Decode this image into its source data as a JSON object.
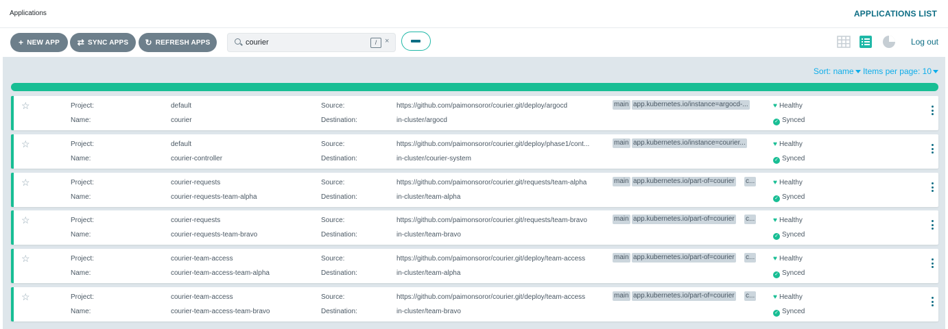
{
  "header": {
    "breadcrumb": "Applications",
    "page_title": "APPLICATIONS LIST"
  },
  "toolbar": {
    "new_app": "NEW APP",
    "sync_apps": "SYNC APPS",
    "refresh_apps": "REFRESH APPS",
    "search_value": "courier",
    "search_shortcut": "/",
    "clear": "×",
    "logout": "Log out"
  },
  "sort": {
    "label": "Sort: name",
    "per_page": "Items per page: 10"
  },
  "labels": {
    "project": "Project:",
    "name": "Name:",
    "source": "Source:",
    "destination": "Destination:",
    "healthy": "Healthy",
    "synced": "Synced"
  },
  "colors": {
    "accent": "#0d6d84",
    "healthy": "#18be94",
    "button": "#6d7f8b"
  },
  "apps": [
    {
      "project": "default",
      "name": "courier",
      "source": "https://github.com/paimonsoror/courier.git/deploy/argocd",
      "revision": "main",
      "label": "app.kubernetes.io/instance=argocd-...",
      "extra": "",
      "destination": "in-cluster/argocd",
      "health": "Healthy",
      "sync": "Synced"
    },
    {
      "project": "default",
      "name": "courier-controller",
      "source": "https://github.com/paimonsoror/courier.git/deploy/phase1/cont...",
      "revision": "main",
      "label": "app.kubernetes.io/instance=courier...",
      "extra": "",
      "destination": "in-cluster/courier-system",
      "health": "Healthy",
      "sync": "Synced"
    },
    {
      "project": "courier-requests",
      "name": "courier-requests-team-alpha",
      "source": "https://github.com/paimonsoror/courier.git/requests/team-alpha",
      "revision": "main",
      "label": "app.kubernetes.io/part-of=courier",
      "extra": "c...",
      "destination": "in-cluster/team-alpha",
      "health": "Healthy",
      "sync": "Synced"
    },
    {
      "project": "courier-requests",
      "name": "courier-requests-team-bravo",
      "source": "https://github.com/paimonsoror/courier.git/requests/team-bravo",
      "revision": "main",
      "label": "app.kubernetes.io/part-of=courier",
      "extra": "c...",
      "destination": "in-cluster/team-bravo",
      "health": "Healthy",
      "sync": "Synced"
    },
    {
      "project": "courier-team-access",
      "name": "courier-team-access-team-alpha",
      "source": "https://github.com/paimonsoror/courier.git/deploy/team-access",
      "revision": "main",
      "label": "app.kubernetes.io/part-of=courier",
      "extra": "c...",
      "destination": "in-cluster/team-alpha",
      "health": "Healthy",
      "sync": "Synced"
    },
    {
      "project": "courier-team-access",
      "name": "courier-team-access-team-bravo",
      "source": "https://github.com/paimonsoror/courier.git/deploy/team-access",
      "revision": "main",
      "label": "app.kubernetes.io/part-of=courier",
      "extra": "c...",
      "destination": "in-cluster/team-bravo",
      "health": "Healthy",
      "sync": "Synced"
    }
  ]
}
